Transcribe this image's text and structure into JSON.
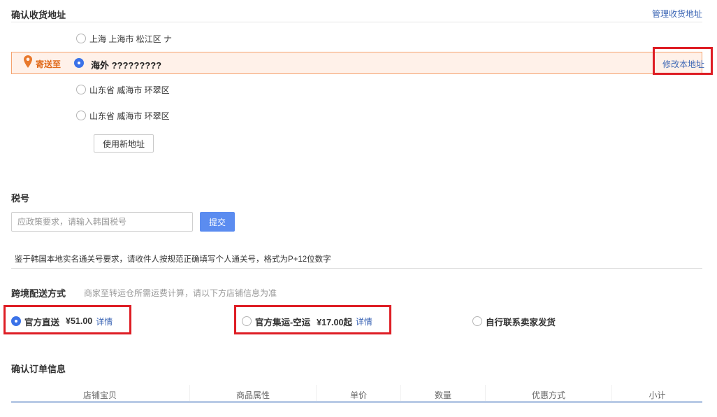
{
  "address": {
    "title": "确认收货地址",
    "manage_link": "管理收货地址",
    "options": [
      {
        "label": "上海 上海市 松江区 ナ"
      },
      {
        "label": "海外 ?????????"
      },
      {
        "label": "山东省 威海市 环翠区"
      },
      {
        "label": "山东省 威海市 环翠区"
      }
    ],
    "selected_index": 1,
    "send_to_label": "寄送至",
    "modify_link": "修改本地址",
    "new_address_button": "使用新地址"
  },
  "tax": {
    "title": "税号",
    "placeholder": "应政策要求，请输入韩国税号",
    "submit_button": "提交",
    "note": "鉴于韩国本地实名通关号要求，请收件人按规范正确填写个人通关号，格式为P+12位数字"
  },
  "shipping": {
    "title": "跨境配送方式",
    "hint": "商家至转运仓所需运费计算，请以下方店铺信息为准",
    "options": [
      {
        "name": "官方直送",
        "price": "¥51.00",
        "detail": "详情",
        "checked": true
      },
      {
        "name": "官方集运-空运",
        "price": "¥17.00起",
        "detail": "详情",
        "checked": false
      },
      {
        "name": "自行联系卖家发货",
        "price": "",
        "detail": "",
        "checked": false
      }
    ]
  },
  "order": {
    "title": "确认订单信息",
    "columns": [
      "店铺宝贝",
      "商品属性",
      "单价",
      "数量",
      "优惠方式",
      "小计"
    ]
  },
  "colors": {
    "accent_blue": "#3b72e8",
    "link_blue": "#3c66b5",
    "highlight_bg": "#fff1e9",
    "highlight_border": "#f5a26e",
    "send_to_orange": "#e06a1b",
    "annotation_red": "#de1d24",
    "submit_blue": "#5b8cf0"
  },
  "icons": {
    "location_pin": "location-pin-icon"
  }
}
